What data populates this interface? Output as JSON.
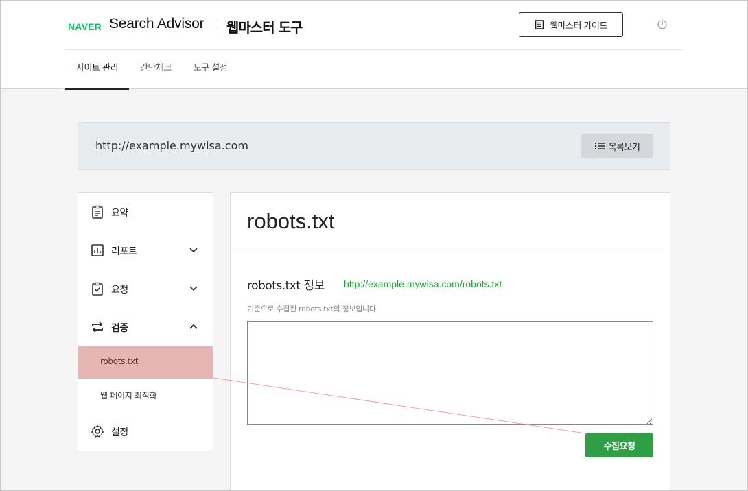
{
  "header": {
    "brand": "NAVER",
    "app_name": "Search Advisor",
    "tool_name": "웹마스터 도구",
    "guide_button": "웹마스터 가이드",
    "power_icon": "power-icon"
  },
  "tabs": [
    {
      "label": "사이트 관리",
      "active": true
    },
    {
      "label": "간단체크",
      "active": false
    },
    {
      "label": "도구 설정",
      "active": false
    }
  ],
  "site_bar": {
    "url": "http://example.mywisa.com",
    "list_button": "목록보기"
  },
  "sidebar": {
    "items": [
      {
        "label": "요약",
        "icon": "clipboard-icon"
      },
      {
        "label": "리포트",
        "icon": "chart-icon",
        "chevron": "chevron-down-icon"
      },
      {
        "label": "요청",
        "icon": "check-clipboard-icon",
        "chevron": "chevron-down-icon"
      },
      {
        "label": "검증",
        "icon": "repeat-arrows-icon",
        "chevron": "chevron-up-icon",
        "expanded": true
      },
      {
        "label": "설정",
        "icon": "gear-icon"
      }
    ],
    "sub_items": [
      {
        "label": "robots.txt",
        "active": true
      },
      {
        "label": "웹 페이지 최적화",
        "active": false
      }
    ]
  },
  "main": {
    "title": "robots.txt",
    "section_title": "robots.txt 정보",
    "section_link": "http://example.mywisa.com/robots.txt",
    "description": "기준으로 수집된 robots.txt의 정보입니다.",
    "robots_content": "",
    "request_button": "수집요청"
  },
  "colors": {
    "brand_green": "#03c75a",
    "link_green": "#1fa336",
    "button_green": "#2f9e44",
    "highlight": "#e8b5b5"
  }
}
